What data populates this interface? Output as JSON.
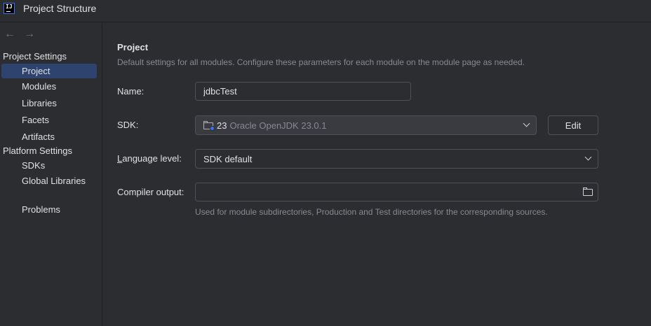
{
  "window": {
    "title": "Project Structure"
  },
  "nav": {
    "back_icon": "arrow-left-icon",
    "forward_icon": "arrow-right-icon",
    "back_glyph": "←",
    "forward_glyph": "→"
  },
  "sidebar": {
    "project_settings_header": "Project Settings",
    "platform_settings_header": "Platform Settings",
    "project_items": [
      "Project",
      "Modules",
      "Libraries",
      "Facets",
      "Artifacts"
    ],
    "platform_items": [
      "SDKs",
      "Global Libraries"
    ],
    "other_items": [
      "Problems"
    ],
    "selected": "Project"
  },
  "main": {
    "title": "Project",
    "description": "Default settings for all modules. Configure these parameters for each module on the module page as needed.",
    "name_label": "Name:",
    "name_value": "jdbcTest",
    "sdk_label": "SDK:",
    "sdk_version": "23",
    "sdk_name": "Oracle OpenJDK 23.0.1",
    "edit_button": "Edit",
    "language_label_prefix": "L",
    "language_label_rest": "anguage level:",
    "language_value": "SDK default",
    "compiler_label": "Compiler output:",
    "compiler_value": "",
    "compiler_hint": "Used for module subdirectories, Production and Test directories for the corresponding sources."
  },
  "colors": {
    "accent": "#3574f0",
    "selection": "#2e436e",
    "background": "#2b2d30"
  }
}
